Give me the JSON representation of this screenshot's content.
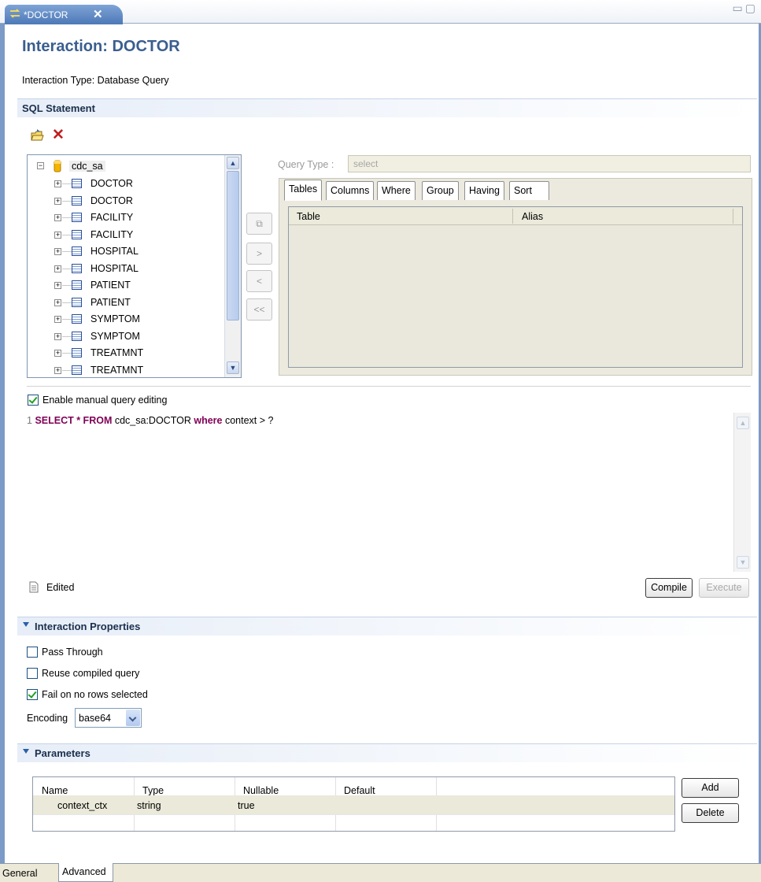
{
  "editor_tab": {
    "title": "*DOCTOR",
    "close": "✕",
    "icon": "interaction-icon"
  },
  "window_controls": {
    "minimize": "▭",
    "maximize": "▢"
  },
  "page_title": "Interaction: DOCTOR",
  "interaction_type": "Interaction Type: Database Query",
  "sql_section": {
    "title": "SQL Statement",
    "toolbar": {
      "open_icon": "open-folder-icon",
      "delete_icon": "delete-x-icon",
      "delete_glyph": "✕"
    },
    "tree": {
      "root": "cdc_sa",
      "items": [
        "DOCTOR",
        "DOCTOR",
        "FACILITY",
        "FACILITY",
        "HOSPITAL",
        "HOSPITAL",
        "PATIENT",
        "PATIENT",
        "SYMPTOM",
        "SYMPTOM",
        "TREATMNT",
        "TREATMNT"
      ]
    },
    "mid_buttons": {
      "add_all": "⧉",
      "add": ">",
      "remove": "<",
      "remove_all": "<<"
    },
    "query_type": {
      "label": "Query Type :",
      "value": "select"
    },
    "tabs": [
      "Tables",
      "Columns",
      "Where",
      "Group",
      "Having",
      "Sort"
    ],
    "tables_columns": [
      "Table",
      "Alias"
    ],
    "manual_edit": {
      "label": "Enable manual query editing",
      "checked": true
    },
    "sql": {
      "line_number": "1",
      "kw1": "SELECT * FROM",
      "table": "cdc_sa:DOCTOR",
      "kw2": "where",
      "cond": "context > ?"
    },
    "status": "Edited",
    "compile": "Compile",
    "execute": "Execute"
  },
  "interaction_properties": {
    "title": "Interaction Properties",
    "pass_through": {
      "label": "Pass Through",
      "checked": false
    },
    "reuse_compiled": {
      "label": "Reuse compiled query",
      "checked": false
    },
    "fail_on_no_rows": {
      "label": "Fail on no rows selected",
      "checked": true
    },
    "encoding": {
      "label": "Encoding",
      "value": "base64"
    }
  },
  "parameters": {
    "title": "Parameters",
    "columns": [
      "Name",
      "Type",
      "Nullable",
      "Default"
    ],
    "rows": [
      {
        "name": "context_ctx",
        "type": "string",
        "nullable": "true",
        "default": ""
      }
    ],
    "add": "Add",
    "delete": "Delete"
  },
  "bottom_tabs": [
    "General",
    "Advanced"
  ],
  "colors": {
    "title_blue": "#3a5e8f",
    "keyword": "#7f0055",
    "section_bg": "#e7eef8"
  }
}
